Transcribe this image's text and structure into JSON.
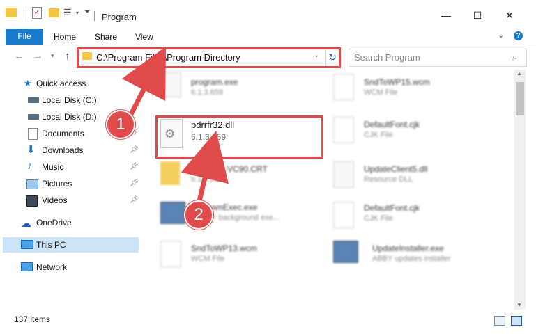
{
  "window": {
    "title": "Program",
    "minimize": "—",
    "maximize": "☐",
    "close": "✕"
  },
  "ribbon": {
    "file": "File",
    "home": "Home",
    "share": "Share",
    "view": "View",
    "help": "?"
  },
  "address": {
    "path": "C:\\Program Files\\Program Directory",
    "search_placeholder": "Search Program"
  },
  "sidebar": {
    "quick_access": "Quick access",
    "items": [
      {
        "label": "Local Disk (C:)",
        "icon": "drive-icon"
      },
      {
        "label": "Local Disk (D:)",
        "icon": "drive-icon"
      },
      {
        "label": "Documents",
        "icon": "documents-icon",
        "pinned": true
      },
      {
        "label": "Downloads",
        "icon": "downloads-icon",
        "pinned": true
      },
      {
        "label": "Music",
        "icon": "music-icon",
        "pinned": true
      },
      {
        "label": "Pictures",
        "icon": "pictures-icon",
        "pinned": true
      },
      {
        "label": "Videos",
        "icon": "videos-icon",
        "pinned": true
      }
    ],
    "onedrive": "OneDrive",
    "this_pc": "This PC",
    "network": "Network"
  },
  "files": {
    "left": [
      {
        "name": "program.exe",
        "sub": "6.1.3.659"
      },
      {
        "name": "pdrrfr32.dll",
        "sub": "6.1.3.659"
      },
      {
        "name": "Microsoft.VC90.CRT",
        "sub": "6.1.3.659"
      },
      {
        "name": "ProgramExec.exe",
        "sub": "ABBYY background exe..."
      },
      {
        "name": "SndToWP13.wcm",
        "sub": "WCM File"
      }
    ],
    "right": [
      {
        "name": "SndToWP15.wcm",
        "sub": "WCM File"
      },
      {
        "name": "DefaultFont.cjk",
        "sub": "CJK File"
      },
      {
        "name": "UpdateClient5.dll",
        "sub": "Resource DLL"
      },
      {
        "name": "DefaultFont.cjk",
        "sub": "CJK File"
      },
      {
        "name": "UpdateInstaller.exe",
        "sub": "ABBY updates installer"
      }
    ]
  },
  "status": {
    "count": "137 items"
  },
  "callouts": {
    "one": "1",
    "two": "2"
  },
  "colors": {
    "accent": "#1979ca",
    "callout": "#e04a4a",
    "selected": "#cce4f7"
  }
}
